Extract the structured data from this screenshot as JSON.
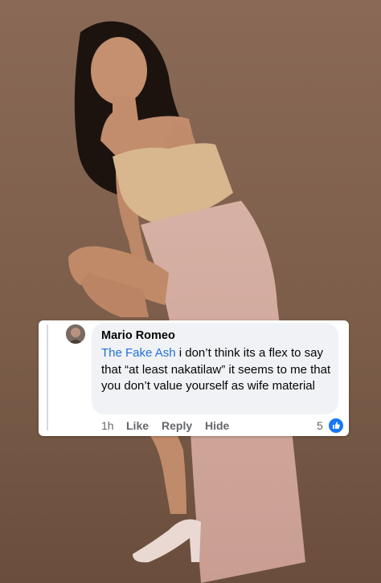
{
  "comment": {
    "author": "Mario Romeo",
    "mention": "The Fake Ash",
    "text": " i don’t think its a flex to say that “at least nakatilaw” it seems to me that you don’t value yourself as wife material",
    "time": "1h",
    "like_label": "Like",
    "reply_label": "Reply",
    "hide_label": "Hide",
    "like_count": "5",
    "like_icon": "thumbs-up-icon"
  },
  "colors": {
    "background": "#7e5f4c",
    "mention": "#216fdb",
    "like_badge": "#1877f2"
  }
}
